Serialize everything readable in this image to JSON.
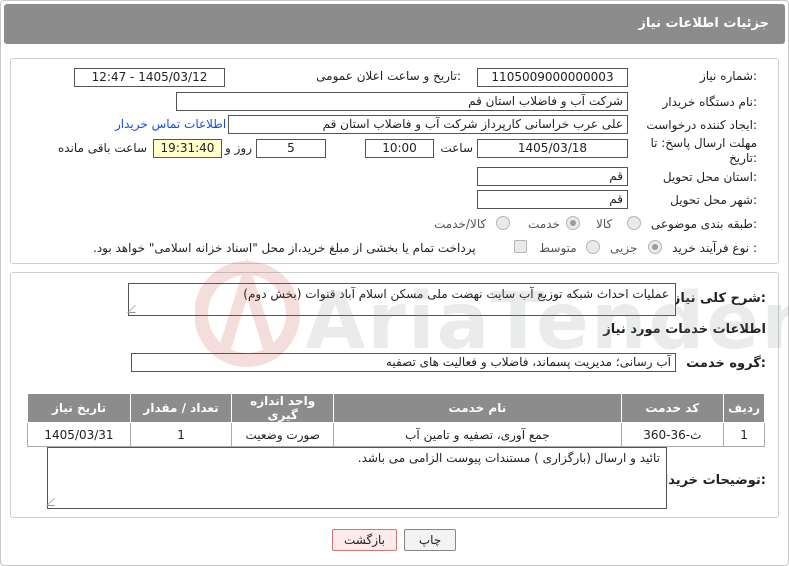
{
  "header": {
    "title": "جزئیات اطلاعات نیاز"
  },
  "form": {
    "need_number_label": "شماره نیاز:",
    "need_number": "1105009000000003",
    "announce_label": "تاریخ و ساعت اعلان عمومی:",
    "announce_value": "1405/03/12 - 12:47",
    "buyer_org_label": "نام دستگاه خریدار:",
    "buyer_org": "شرکت آب و فاضلاب استان قم",
    "creator_label": "ایجاد کننده درخواست:",
    "creator": "علی عرب خراسانی کارپرداز شرکت آب و فاضلاب استان قم",
    "contact_link": "اطلاعات تماس خریدار",
    "deadline_label": "مهلت ارسال پاسخ: تا تاریخ:",
    "deadline_date": "1405/03/18",
    "time_label": "ساعت",
    "deadline_time": "10:00",
    "days_value": "5",
    "days_label": "روز و",
    "remaining_time": "19:31:40",
    "remaining_label": "ساعت باقی مانده",
    "province_label": "استان محل تحویل:",
    "province": "قم",
    "city_label": "شهر محل تحویل:",
    "city": "قم",
    "category_label": "طبقه بندی موضوعی:",
    "category_options": [
      "کالا",
      "خدمت",
      "کالا/خدمت"
    ],
    "category_selected": "خدمت",
    "process_label": "نوع فرآیند خرید :",
    "process_options": [
      "جزیی",
      "متوسط"
    ],
    "process_selected": "جزیی",
    "treasury_note": "پرداخت تمام یا بخشی از مبلغ خرید،از محل \"اسناد خزانه اسلامی\" خواهد بود."
  },
  "summary": {
    "label": "شرح کلی نیاز:",
    "text": "عملیات احداث شبکه توزیع آب سایت نهضت ملی مسکن اسلام آباد قنوات (بخش دوم)"
  },
  "services": {
    "section_title": "اطلاعات خدمات مورد نیاز",
    "group_label": "گروه خدمت:",
    "group_value": "آب رسانی؛ مدیریت پسماند، فاضلاب و فعالیت های تصفیه",
    "columns": [
      "ردیف",
      "کد خدمت",
      "نام خدمت",
      "واحد اندازه گیری",
      "تعداد / مقدار",
      "تاریخ نیاز"
    ],
    "rows": [
      [
        "1",
        "ث-36-360",
        "جمع آوری، تصفیه و تامین آب",
        "صورت وضعیت",
        "1",
        "1405/03/31"
      ]
    ]
  },
  "buyer_notes": {
    "label": "توضیحات خریدار:",
    "text": "تائید و ارسال (بارگزاری ) مستندات پیوست الزامی می باشد."
  },
  "buttons": {
    "print": "چاپ",
    "back": "بازگشت"
  },
  "watermark": {
    "text": "AriaTender.net"
  },
  "colors": {
    "header": "#8c8c8c",
    "link": "#1a4fd6",
    "yellow_field": "#ffffcc",
    "back_button": "#fdeaea"
  }
}
